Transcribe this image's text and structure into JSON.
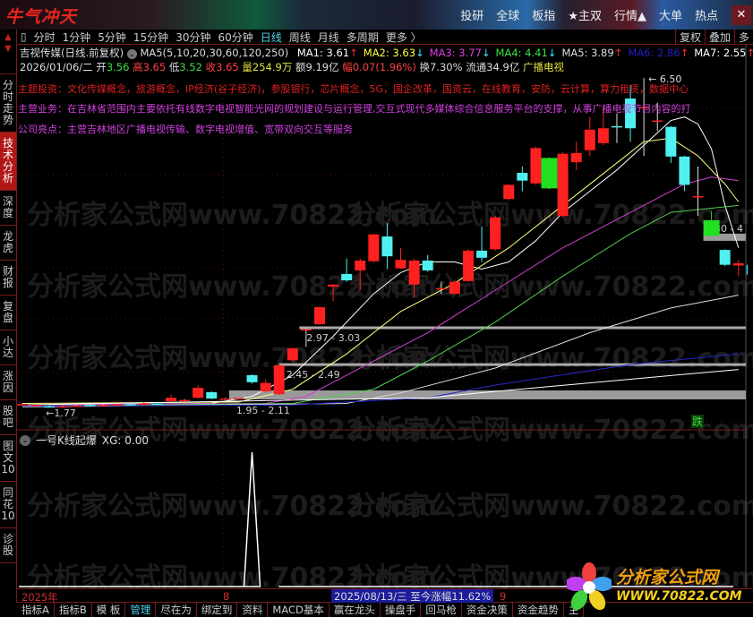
{
  "titlebar": {
    "logo": "牛气冲天",
    "menu": [
      "投研",
      "全球",
      "板指",
      "★主双",
      "行情▲",
      "大单",
      "热点"
    ],
    "close": "✕"
  },
  "toolbar": {
    "periods": [
      "分时",
      "1分钟",
      "5分钟",
      "15分钟",
      "30分钟",
      "60分钟",
      "日线",
      "周线",
      "月线",
      "多周期",
      "更多 〉"
    ],
    "active": "日线",
    "right": [
      "复权",
      "叠加",
      "多"
    ]
  },
  "sidebar": {
    "tabs": [
      "分时走势",
      "技术分析",
      "深度",
      "龙虎",
      "财报",
      "复盘",
      "小达",
      "涨因",
      "股吧",
      "图文10",
      "同花10",
      "诊股"
    ],
    "active": "技术分析"
  },
  "stock": {
    "name": "吉视传媒(日线.前复权)",
    "ma_label": "MA5(5,10,20,30,60,120,250)",
    "mas": [
      {
        "label": "MA1: 3.61",
        "arrow": "↑",
        "color": "#ffffff",
        "arrow_color": "#ff3030"
      },
      {
        "label": "MA2: 3.63",
        "arrow": "↓",
        "color": "#ffff40",
        "arrow_color": "#40e0ff"
      },
      {
        "label": "MA3: 3.77",
        "arrow": "↓",
        "color": "#e040e0",
        "arrow_color": "#40e0ff"
      },
      {
        "label": "MA4: 4.41",
        "arrow": "↓",
        "color": "#40e040",
        "arrow_color": "#40e0ff"
      },
      {
        "label": "MA5: 3.89",
        "arrow": "↑",
        "color": "#dddddd",
        "arrow_color": "#ff3030"
      },
      {
        "label": "MA6: 2.86",
        "arrow": "↑",
        "color": "#2020c0",
        "arrow_color": "#ff3030"
      },
      {
        "label": "MA7: 2.55",
        "arrow": "↑",
        "color": "#ffffff",
        "arrow_color": "#ff3030"
      }
    ],
    "date": "2026/01/06/二",
    "open_l": "开",
    "open": "3.56",
    "high_l": "高",
    "high": "3.65",
    "low_l": "低",
    "low": "3.52",
    "close_l": "收",
    "close": "3.65",
    "vol": "量254.9万",
    "amount": "额9.19亿",
    "change": "幅0.07(1.96%)",
    "turnover": "换7.30%",
    "float": "流通34.9亿",
    "industry": "广播电视"
  },
  "themes": [
    {
      "text": "主题投资：文化传媒概念，旅游概念，IP经济(谷子经济)，参股银行，芯片概念，5G，国企改革，国资云，在线教育，安防，云计算，算力租赁，数据中心",
      "color": "#e02020"
    },
    {
      "text": "主营业务：在吉林省范围内主要依托有线数字电视智能光网的规划建设与运行管理,交互式现代多媒体综合信息服务平台的支撑，从事广播电视节目内容的打",
      "color": "#d040e0"
    },
    {
      "text": "公司亮点：主营吉林地区广播电视传输、数字电视增值、宽带双向交互等服务",
      "color": "#d040e0"
    }
  ],
  "watermark": "分析家公式网www.70822.com",
  "chart_data": {
    "type": "candlestick",
    "price_range": [
      1.7,
      6.6
    ],
    "candles": [
      {
        "o": 1.88,
        "c": 1.89,
        "h": 1.9,
        "l": 1.87
      },
      {
        "o": 1.87,
        "c": 1.88,
        "h": 1.89,
        "l": 1.86
      },
      {
        "o": 1.86,
        "c": 1.85,
        "h": 1.87,
        "l": 1.84
      },
      {
        "o": 1.85,
        "c": 1.86,
        "h": 1.87,
        "l": 1.84
      },
      {
        "o": 1.86,
        "c": 1.87,
        "h": 1.88,
        "l": 1.85
      },
      {
        "o": 1.88,
        "c": 1.87,
        "h": 1.89,
        "l": 1.86
      },
      {
        "o": 1.87,
        "c": 1.88,
        "h": 1.89,
        "l": 1.86
      },
      {
        "o": 1.88,
        "c": 1.89,
        "h": 1.9,
        "l": 1.87
      },
      {
        "o": 1.89,
        "c": 1.88,
        "h": 1.91,
        "l": 1.87
      },
      {
        "o": 1.88,
        "c": 1.9,
        "h": 1.92,
        "l": 1.87
      },
      {
        "o": 1.9,
        "c": 1.89,
        "h": 1.91,
        "l": 1.88
      },
      {
        "o": 1.93,
        "c": 1.98,
        "h": 2.02,
        "l": 1.92
      },
      {
        "o": 1.94,
        "c": 1.95,
        "h": 1.96,
        "l": 1.93
      },
      {
        "o": 1.98,
        "c": 2.12,
        "h": 2.16,
        "l": 1.97
      },
      {
        "o": 2.06,
        "c": 1.97,
        "h": 2.07,
        "l": 1.96
      },
      {
        "o": 1.96,
        "c": 1.97,
        "h": 1.98,
        "l": 1.95
      },
      {
        "o": 1.97,
        "c": 1.98,
        "h": 1.99,
        "l": 1.96
      },
      {
        "o": 2.3,
        "c": 2.2,
        "h": 2.31,
        "l": 2.18
      },
      {
        "o": 2.07,
        "c": 2.19,
        "h": 2.24,
        "l": 2.05
      },
      {
        "o": 2.03,
        "c": 2.44,
        "h": 2.45,
        "l": 2.02
      },
      {
        "o": 2.51,
        "c": 2.68,
        "h": 2.69,
        "l": 2.49
      },
      {
        "o": 2.94,
        "c": 2.95,
        "h": 2.96,
        "l": 2.7
      },
      {
        "o": 3.02,
        "c": 3.26,
        "h": 3.27,
        "l": 3.01
      },
      {
        "o": 3.55,
        "c": 3.58,
        "h": 3.59,
        "l": 3.35
      },
      {
        "o": 3.73,
        "c": 3.64,
        "h": 3.95,
        "l": 3.62
      },
      {
        "o": 3.78,
        "c": 3.92,
        "h": 3.95,
        "l": 3.5
      },
      {
        "o": 3.91,
        "c": 4.29,
        "h": 4.3,
        "l": 3.89
      },
      {
        "o": 4.26,
        "c": 3.98,
        "h": 4.45,
        "l": 3.8
      },
      {
        "o": 3.81,
        "c": 3.93,
        "h": 4.1,
        "l": 3.8
      },
      {
        "o": 3.58,
        "c": 3.92,
        "h": 3.95,
        "l": 3.4
      },
      {
        "o": 3.92,
        "c": 3.78,
        "h": 4.0,
        "l": 3.76
      },
      {
        "o": 3.52,
        "c": 3.53,
        "h": 3.62,
        "l": 3.45
      },
      {
        "o": 3.45,
        "c": 3.62,
        "h": 3.65,
        "l": 3.43
      },
      {
        "o": 3.63,
        "c": 4.06,
        "h": 4.08,
        "l": 3.62
      },
      {
        "o": 4.06,
        "c": 3.96,
        "h": 4.4,
        "l": 3.9
      },
      {
        "o": 4.08,
        "c": 4.53,
        "h": 4.55,
        "l": 4.06
      },
      {
        "o": 4.79,
        "c": 4.99,
        "h": 5.0,
        "l": 4.77
      },
      {
        "o": 5.16,
        "c": 5.05,
        "h": 5.25,
        "l": 4.9
      },
      {
        "o": 5.01,
        "c": 5.51,
        "h": 5.53,
        "l": 4.99
      },
      {
        "o": 5.37,
        "c": 4.94,
        "h": 5.38,
        "l": 4.93,
        "limit": true
      },
      {
        "o": 4.55,
        "c": 5.43,
        "h": 5.45,
        "l": 4.53
      },
      {
        "o": 5.31,
        "c": 5.44,
        "h": 5.6,
        "l": 5.2
      },
      {
        "o": 5.48,
        "c": 5.77,
        "h": 5.95,
        "l": 5.4
      },
      {
        "o": 5.58,
        "c": 5.79,
        "h": 6.1,
        "l": 5.55
      },
      {
        "o": 5.82,
        "c": 5.81,
        "h": 6.0,
        "l": 5.58
      },
      {
        "o": 6.21,
        "c": 5.79,
        "h": 6.4,
        "l": 5.6
      },
      {
        "o": 6.08,
        "c": 6.09,
        "h": 6.5,
        "l": 5.4
      },
      {
        "o": 5.89,
        "c": 5.9,
        "h": 6.15,
        "l": 5.75
      },
      {
        "o": 5.81,
        "c": 5.39,
        "h": 5.82,
        "l": 5.3
      },
      {
        "o": 5.39,
        "c": 4.99,
        "h": 5.4,
        "l": 4.9
      },
      {
        "o": 4.82,
        "c": 4.83,
        "h": 5.25,
        "l": 4.55
      },
      {
        "o": 4.49,
        "c": 4.27,
        "h": 4.62,
        "l": 4.26,
        "limit": true
      },
      {
        "o": 4.07,
        "c": 3.86,
        "h": 4.08,
        "l": 3.84
      },
      {
        "o": 3.85,
        "c": 3.88,
        "h": 3.93,
        "l": 3.7
      },
      {
        "o": 3.86,
        "c": 3.72,
        "h": 3.87,
        "l": 3.7
      }
    ],
    "ma_series": [
      {
        "name": "MA1",
        "color": "#ffffff",
        "points": [
          [
            0,
            1.88
          ],
          [
            14,
            1.9
          ],
          [
            17,
            2.0
          ],
          [
            20,
            2.3
          ],
          [
            23,
            2.85
          ],
          [
            26,
            3.45
          ],
          [
            28,
            3.75
          ],
          [
            30,
            3.9
          ],
          [
            32,
            3.9
          ],
          [
            34,
            3.8
          ],
          [
            36,
            3.9
          ],
          [
            38,
            4.2
          ],
          [
            40,
            4.6
          ],
          [
            42,
            4.9
          ],
          [
            44,
            5.2
          ],
          [
            46,
            5.55
          ],
          [
            48,
            5.9
          ],
          [
            49,
            5.95
          ],
          [
            50,
            5.85
          ],
          [
            51,
            5.5
          ],
          [
            52,
            4.7
          ],
          [
            53,
            4.1
          ]
        ]
      },
      {
        "name": "MA2",
        "color": "#ffff80",
        "points": [
          [
            0,
            1.9
          ],
          [
            16,
            1.92
          ],
          [
            20,
            2.1
          ],
          [
            24,
            2.6
          ],
          [
            28,
            3.2
          ],
          [
            32,
            3.6
          ],
          [
            36,
            4.1
          ],
          [
            40,
            4.7
          ],
          [
            44,
            5.3
          ],
          [
            46,
            5.6
          ],
          [
            48,
            5.65
          ],
          [
            50,
            5.4
          ],
          [
            52,
            5.0
          ],
          [
            53,
            4.75
          ]
        ]
      },
      {
        "name": "MA3",
        "color": "#d040d0",
        "points": [
          [
            0,
            1.88
          ],
          [
            18,
            1.9
          ],
          [
            21,
            2.0
          ],
          [
            26,
            2.5
          ],
          [
            30,
            2.9
          ],
          [
            35,
            3.5
          ],
          [
            40,
            4.1
          ],
          [
            45,
            4.6
          ],
          [
            49,
            5.0
          ],
          [
            51,
            5.1
          ],
          [
            53,
            5.05
          ]
        ]
      },
      {
        "name": "MA4",
        "color": "#50d050",
        "points": [
          [
            0,
            1.86
          ],
          [
            20,
            1.9
          ],
          [
            26,
            2.1
          ],
          [
            30,
            2.5
          ],
          [
            35,
            3.05
          ],
          [
            40,
            3.7
          ],
          [
            45,
            4.3
          ],
          [
            48,
            4.6
          ],
          [
            53,
            4.7
          ]
        ]
      },
      {
        "name": "MA5",
        "color": "#dddddd",
        "points": [
          [
            0,
            1.85
          ],
          [
            24,
            1.9
          ],
          [
            28,
            2.05
          ],
          [
            35,
            2.4
          ],
          [
            42,
            2.9
          ],
          [
            48,
            3.25
          ],
          [
            53,
            3.43
          ]
        ]
      },
      {
        "name": "MA6",
        "color": "#2828c8",
        "points": [
          [
            0,
            1.86
          ],
          [
            20,
            1.88
          ],
          [
            30,
            1.98
          ],
          [
            35,
            2.16
          ],
          [
            45,
            2.45
          ],
          [
            53,
            2.6
          ]
        ]
      },
      {
        "name": "MA7",
        "color": "#ffffff",
        "points": [
          [
            0,
            1.88
          ],
          [
            30,
            1.98
          ],
          [
            35,
            2.07
          ],
          [
            53,
            2.38
          ]
        ]
      }
    ],
    "levels": [
      {
        "from": 20.5,
        "price": 2.97,
        "label": "2.97 - 3.03"
      },
      {
        "from": 19,
        "price": 2.45,
        "label": "2.45 - 2.49"
      },
      {
        "from": 15.3,
        "price": 1.95,
        "price2": 2.11,
        "label": "1.95 - 2.11"
      },
      {
        "from": 50.4,
        "price": 4.3,
        "price2": 4.2,
        "label": "4.30 - 4"
      }
    ],
    "annotations": {
      "high": "6.50",
      "low": "1.77",
      "fall_tag": "跌"
    },
    "sub": {
      "title": "一号K线起爆",
      "value": "XG: 0.00",
      "signal_index": 17
    }
  },
  "timeaxis": {
    "year": "2025年",
    "m8": "8",
    "cursor": "2025/08/13/三  至今涨幅11.62%",
    "m9": "9"
  },
  "bottomtabs": [
    "指标A",
    "指标B",
    "模 板",
    "管理",
    "尽在为",
    "绑定到",
    "资料",
    "MACD基本",
    "赢在龙头",
    "操盘手",
    "回马枪",
    "资金决策",
    "资金趋势",
    "主"
  ],
  "bottom_active": "管理",
  "brand": {
    "name": "分析家公式网",
    "url": "WWW.70822.COM"
  }
}
